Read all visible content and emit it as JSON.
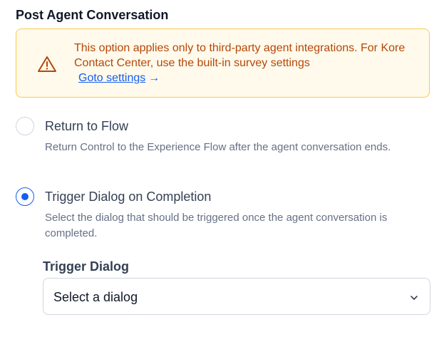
{
  "section": {
    "title": "Post Agent Conversation"
  },
  "warning": {
    "icon": "warning-triangle-icon",
    "message": "This option applies only to third-party agent integrations. For Kore Contact Center, use the built-in survey settings",
    "link_label": "Goto settings",
    "link_arrow": "→",
    "colors": {
      "background": "#fffaeb",
      "border": "#fec84b",
      "text": "#b54708",
      "link": "#155eef"
    }
  },
  "options": [
    {
      "label": "Return to Flow",
      "description": "Return Control to the Experience Flow after the agent conversation ends.",
      "selected": false
    },
    {
      "label": "Trigger Dialog on Completion",
      "description": "Select the dialog that should be triggered once the agent conversation is completed.",
      "selected": true
    }
  ],
  "trigger_dialog": {
    "label": "Trigger Dialog",
    "value": "Select a dialog",
    "icon": "chevron-down-icon"
  },
  "accent_color": "#155eef"
}
